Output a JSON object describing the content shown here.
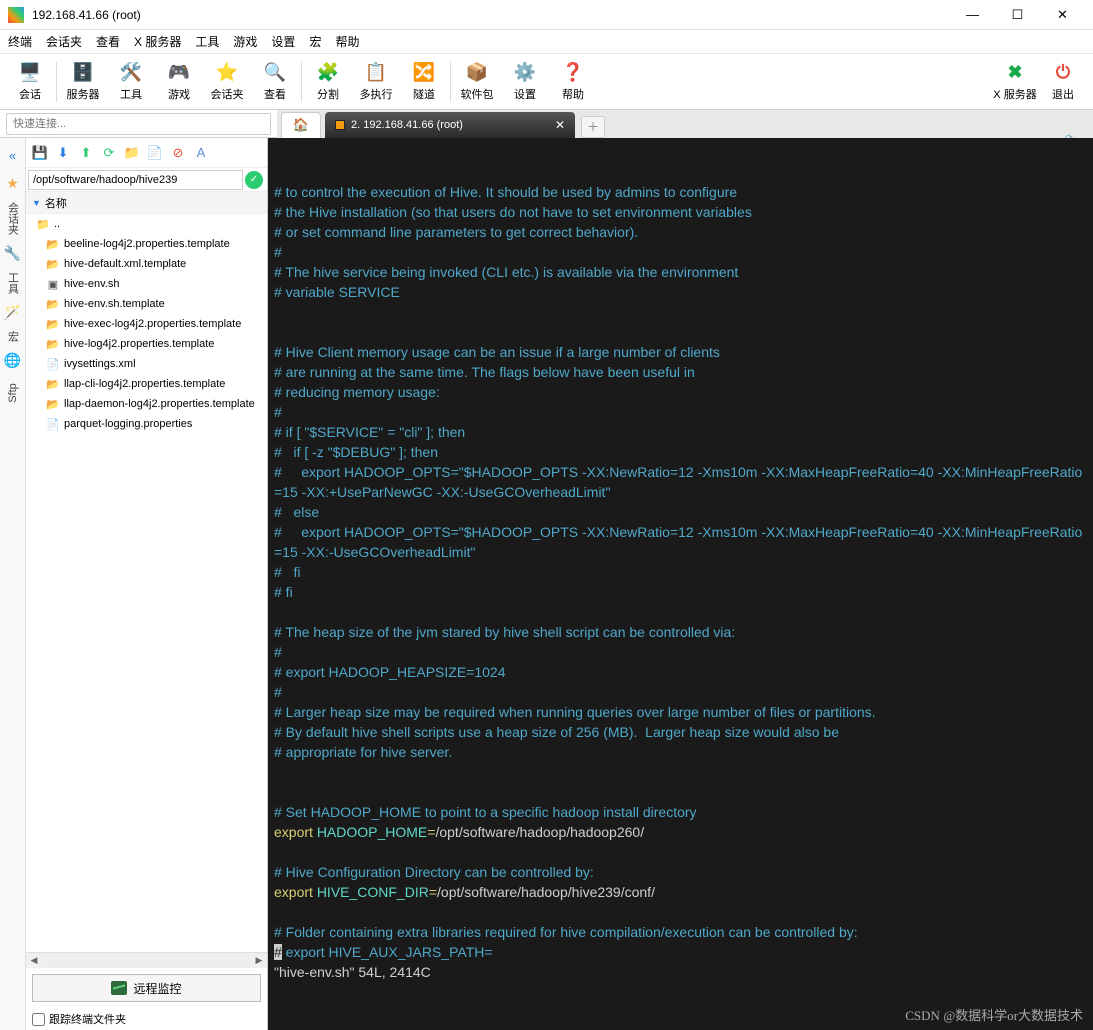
{
  "window": {
    "title": "192.168.41.66 (root)"
  },
  "menu": {
    "items": [
      "终端",
      "会话夹",
      "查看",
      "X 服务器",
      "工具",
      "游戏",
      "设置",
      "宏",
      "帮助"
    ]
  },
  "toolbar": {
    "btns": [
      {
        "label": "会话",
        "icon": "🖥️"
      },
      {
        "label": "服务器",
        "icon": "🗄️"
      },
      {
        "label": "工具",
        "icon": "🛠️"
      },
      {
        "label": "游戏",
        "icon": "🎮"
      },
      {
        "label": "会话夹",
        "icon": "⭐"
      },
      {
        "label": "查看",
        "icon": "🔍"
      },
      {
        "label": "分割",
        "icon": "🧩"
      },
      {
        "label": "多执行",
        "icon": "📋"
      },
      {
        "label": "隧道",
        "icon": "🔀"
      },
      {
        "label": "软件包",
        "icon": "📦"
      },
      {
        "label": "设置",
        "icon": "⚙️"
      },
      {
        "label": "帮助",
        "icon": "❓"
      }
    ],
    "right": [
      {
        "label": "X 服务器",
        "icon": "✖",
        "color": "#1ba94c"
      },
      {
        "label": "退出",
        "icon": "⏻",
        "color": "#e74c3c"
      }
    ]
  },
  "quick": {
    "placeholder": "快速连接..."
  },
  "tabs": {
    "active": "2. 192.168.41.66 (root)"
  },
  "side": {
    "sessions": "会话夹",
    "tools": "工具",
    "macros": "宏",
    "sftp": "Sftp"
  },
  "explorer": {
    "path": "/opt/software/hadoop/hive239",
    "header": "名称",
    "up": "..",
    "files": [
      {
        "name": "beeline-log4j2.properties.template",
        "icon": "folder"
      },
      {
        "name": "hive-default.xml.template",
        "icon": "folder"
      },
      {
        "name": "hive-env.sh",
        "icon": "sh"
      },
      {
        "name": "hive-env.sh.template",
        "icon": "folder"
      },
      {
        "name": "hive-exec-log4j2.properties.template",
        "icon": "folder"
      },
      {
        "name": "hive-log4j2.properties.template",
        "icon": "folder"
      },
      {
        "name": "ivysettings.xml",
        "icon": "file"
      },
      {
        "name": "llap-cli-log4j2.properties.template",
        "icon": "folder"
      },
      {
        "name": "llap-daemon-log4j2.properties.template",
        "icon": "folder"
      },
      {
        "name": "parquet-logging.properties",
        "icon": "file"
      }
    ],
    "remote_monitor": "远程监控",
    "follow": "跟踪终端文件夹"
  },
  "term": {
    "lines": [
      {
        "t": "cmt",
        "s": "# to control the execution of Hive. It should be used by admins to configure"
      },
      {
        "t": "cmt",
        "s": "# the Hive installation (so that users do not have to set environment variables"
      },
      {
        "t": "cmt",
        "s": "# or set command line parameters to get correct behavior)."
      },
      {
        "t": "cmt",
        "s": "#"
      },
      {
        "t": "cmt",
        "s": "# The hive service being invoked (CLI etc.) is available via the environment"
      },
      {
        "t": "cmt",
        "s": "# variable SERVICE"
      },
      {
        "t": "blank",
        "s": ""
      },
      {
        "t": "blank",
        "s": ""
      },
      {
        "t": "cmt",
        "s": "# Hive Client memory usage can be an issue if a large number of clients"
      },
      {
        "t": "cmt",
        "s": "# are running at the same time. The flags below have been useful in"
      },
      {
        "t": "cmt",
        "s": "# reducing memory usage:"
      },
      {
        "t": "cmt",
        "s": "#"
      },
      {
        "t": "cmt",
        "s": "# if [ \"$SERVICE\" = \"cli\" ]; then"
      },
      {
        "t": "cmt",
        "s": "#   if [ -z \"$DEBUG\" ]; then"
      },
      {
        "t": "cmt",
        "s": "#     export HADOOP_OPTS=\"$HADOOP_OPTS -XX:NewRatio=12 -Xms10m -XX:MaxHeapFreeRatio=40 -XX:MinHeapFreeRatio=15 -XX:+UseParNewGC -XX:-UseGCOverheadLimit\""
      },
      {
        "t": "cmt",
        "s": "#   else"
      },
      {
        "t": "cmt",
        "s": "#     export HADOOP_OPTS=\"$HADOOP_OPTS -XX:NewRatio=12 -Xms10m -XX:MaxHeapFreeRatio=40 -XX:MinHeapFreeRatio=15 -XX:-UseGCOverheadLimit\""
      },
      {
        "t": "cmt",
        "s": "#   fi"
      },
      {
        "t": "cmt",
        "s": "# fi"
      },
      {
        "t": "blank",
        "s": ""
      },
      {
        "t": "cmt",
        "s": "# The heap size of the jvm stared by hive shell script can be controlled via:"
      },
      {
        "t": "cmt",
        "s": "#"
      },
      {
        "t": "cmt",
        "s": "# export HADOOP_HEAPSIZE=1024"
      },
      {
        "t": "cmt",
        "s": "#"
      },
      {
        "t": "cmt",
        "s": "# Larger heap size may be required when running queries over large number of files or partitions."
      },
      {
        "t": "cmt",
        "s": "# By default hive shell scripts use a heap size of 256 (MB).  Larger heap size would also be"
      },
      {
        "t": "cmt",
        "s": "# appropriate for hive server."
      },
      {
        "t": "blank",
        "s": ""
      },
      {
        "t": "blank",
        "s": ""
      },
      {
        "t": "cmt",
        "s": "# Set HADOOP_HOME to point to a specific hadoop install directory"
      },
      {
        "t": "exp",
        "kw": "export",
        "var": "HADOOP_HOME",
        "val": "/opt/software/hadoop/hadoop260/"
      },
      {
        "t": "blank",
        "s": ""
      },
      {
        "t": "cmt",
        "s": "# Hive Configuration Directory can be controlled by:"
      },
      {
        "t": "exp",
        "kw": "export",
        "var": "HIVE_CONF_DIR",
        "val": "/opt/software/hadoop/hive239/conf/"
      },
      {
        "t": "blank",
        "s": ""
      },
      {
        "t": "cmt",
        "s": "# Folder containing extra libraries required for hive compilation/execution can be controlled by:"
      },
      {
        "t": "cur",
        "pre": "#",
        "post": " export HIVE_AUX_JARS_PATH="
      },
      {
        "t": "stat",
        "s": "\"hive-env.sh\" 54L, 2414C"
      }
    ]
  },
  "watermark": "CSDN @数据科学or大数据技术"
}
